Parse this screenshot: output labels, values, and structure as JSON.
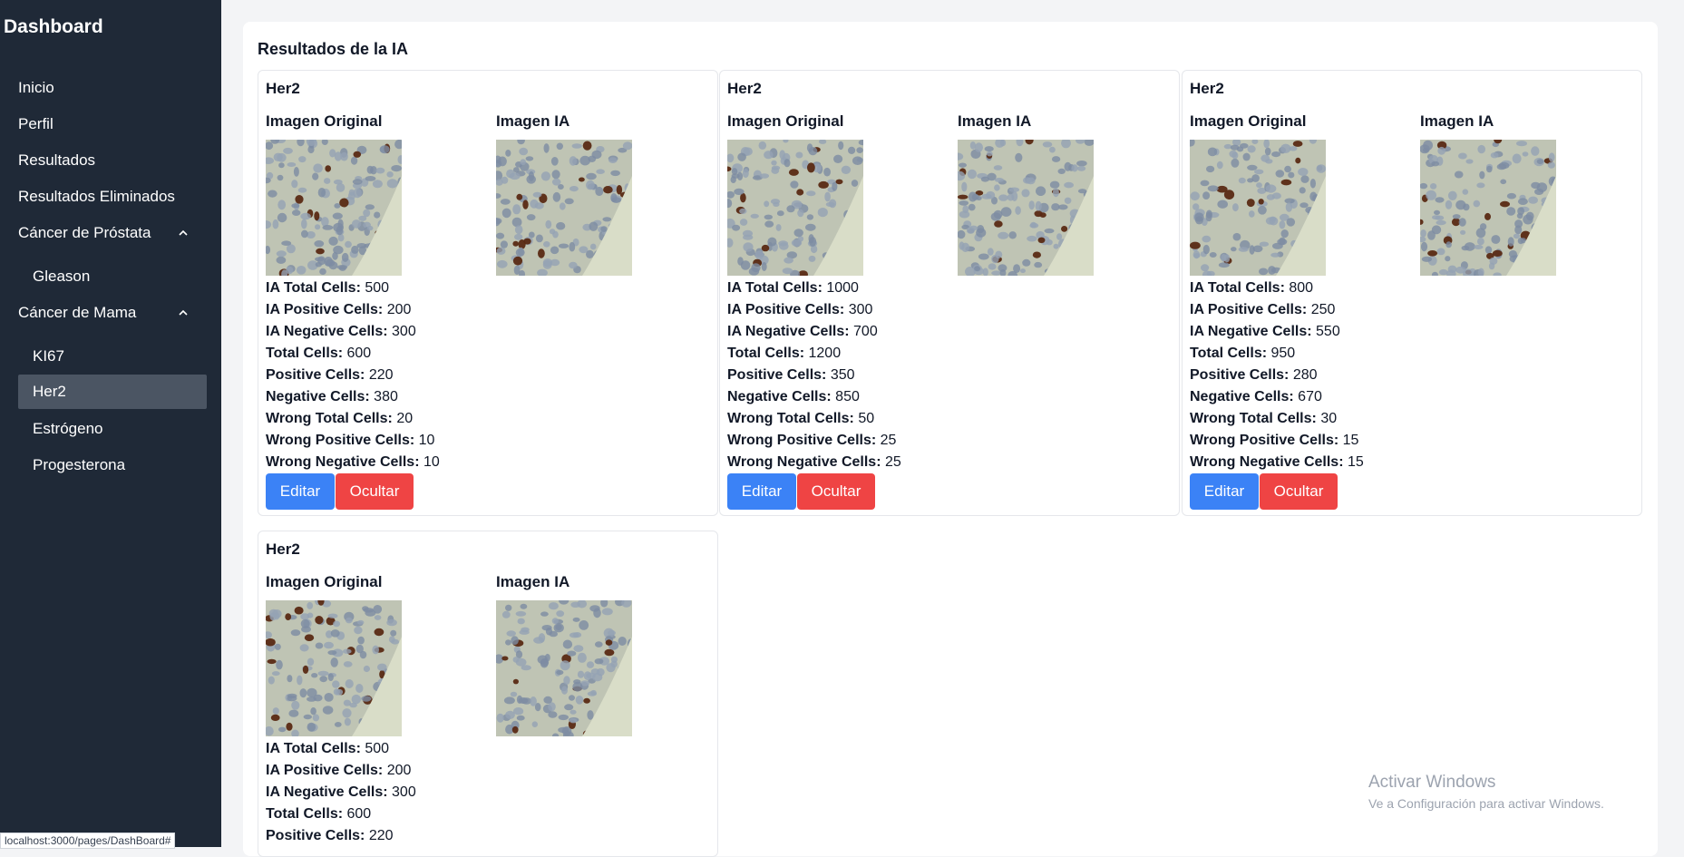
{
  "sidebar": {
    "brand": "Dashboard",
    "items": [
      {
        "label": "Inicio"
      },
      {
        "label": "Perfil"
      },
      {
        "label": "Resultados"
      },
      {
        "label": "Resultados Eliminados"
      },
      {
        "label": "Cáncer de Próstata"
      },
      {
        "label": "Gleason"
      },
      {
        "label": "Cáncer de Mama"
      },
      {
        "label": "KI67"
      },
      {
        "label": "Her2"
      },
      {
        "label": "Estrógeno"
      },
      {
        "label": "Progesterona"
      }
    ]
  },
  "main": {
    "title": "Resultados de la IA",
    "image_original_label": "Imagen Original",
    "image_ia_label": "Imagen IA",
    "edit_label": "Editar",
    "hide_label": "Ocultar",
    "stat_labels": {
      "ia_total": "IA Total Cells:",
      "ia_positive": "IA Positive Cells:",
      "ia_negative": "IA Negative Cells:",
      "total": "Total Cells:",
      "positive": "Positive Cells:",
      "negative": "Negative Cells:",
      "wrong_total": "Wrong Total Cells:",
      "wrong_positive": "Wrong Positive Cells:",
      "wrong_negative": "Wrong Negative Cells:"
    },
    "cards": [
      {
        "title": "Her2",
        "ia_total": "500",
        "ia_positive": "200",
        "ia_negative": "300",
        "total": "600",
        "positive": "220",
        "negative": "380",
        "wrong_total": "20",
        "wrong_positive": "10",
        "wrong_negative": "10"
      },
      {
        "title": "Her2",
        "ia_total": "1000",
        "ia_positive": "300",
        "ia_negative": "700",
        "total": "1200",
        "positive": "350",
        "negative": "850",
        "wrong_total": "50",
        "wrong_positive": "25",
        "wrong_negative": "25"
      },
      {
        "title": "Her2",
        "ia_total": "800",
        "ia_positive": "250",
        "ia_negative": "550",
        "total": "950",
        "positive": "280",
        "negative": "670",
        "wrong_total": "30",
        "wrong_positive": "15",
        "wrong_negative": "15"
      },
      {
        "title": "Her2",
        "ia_total": "500",
        "ia_positive": "200",
        "ia_negative": "300",
        "total": "600",
        "positive": "220"
      }
    ]
  },
  "watermark": {
    "line1": "Activar Windows",
    "line2": "Ve a Configuración para activar Windows."
  },
  "statusbar": {
    "url": "localhost:3000/pages/DashBoard#"
  },
  "colors": {
    "sidebar_bg": "#1f2937",
    "active_item_bg": "#4b5563",
    "edit_button": "#3b82f6",
    "hide_button": "#ef4444"
  }
}
